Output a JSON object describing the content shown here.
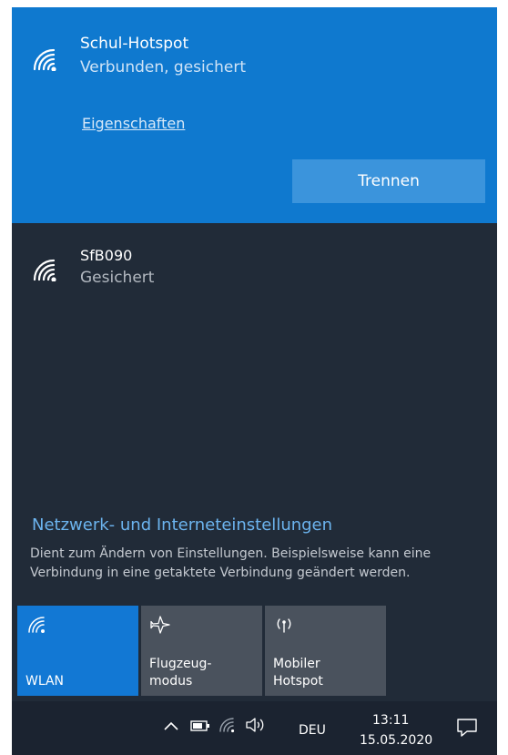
{
  "active_network": {
    "name": "Schul-Hotspot",
    "status": "Verbunden, gesichert",
    "properties_link": "Eigenschaften",
    "disconnect_label": "Trennen",
    "icon": "wifi-signal-icon"
  },
  "networks": [
    {
      "name": "SfB090",
      "status": "Gesichert",
      "icon": "wifi-signal-icon"
    }
  ],
  "settings": {
    "title": "Netzwerk- und Interneteinstellungen",
    "description": "Dient zum Ändern von Einstellungen. Beispielsweise kann eine Verbindung in eine getaktete Verbindung geändert werden."
  },
  "quick_actions": [
    {
      "label": "WLAN",
      "icon": "wifi-icon",
      "active": true
    },
    {
      "label": "Flugzeug-\nmodus",
      "icon": "airplane-icon",
      "active": false
    },
    {
      "label": "Mobiler\nHotspot",
      "icon": "hotspot-icon",
      "active": false
    }
  ],
  "taskbar": {
    "language": "DEU",
    "time": "13:11",
    "date": "15.05.2020",
    "icons": [
      "chevron-up-icon",
      "battery-icon",
      "wifi-icon",
      "speaker-icon",
      "action-center-icon"
    ]
  },
  "colors": {
    "panel_bg": "#212b38",
    "active_bg": "#0f79cf",
    "button_bg": "#3b94dc",
    "tile_active": "#1278d4",
    "tile_inactive": "#4a525d",
    "link": "#6cb4ef"
  }
}
